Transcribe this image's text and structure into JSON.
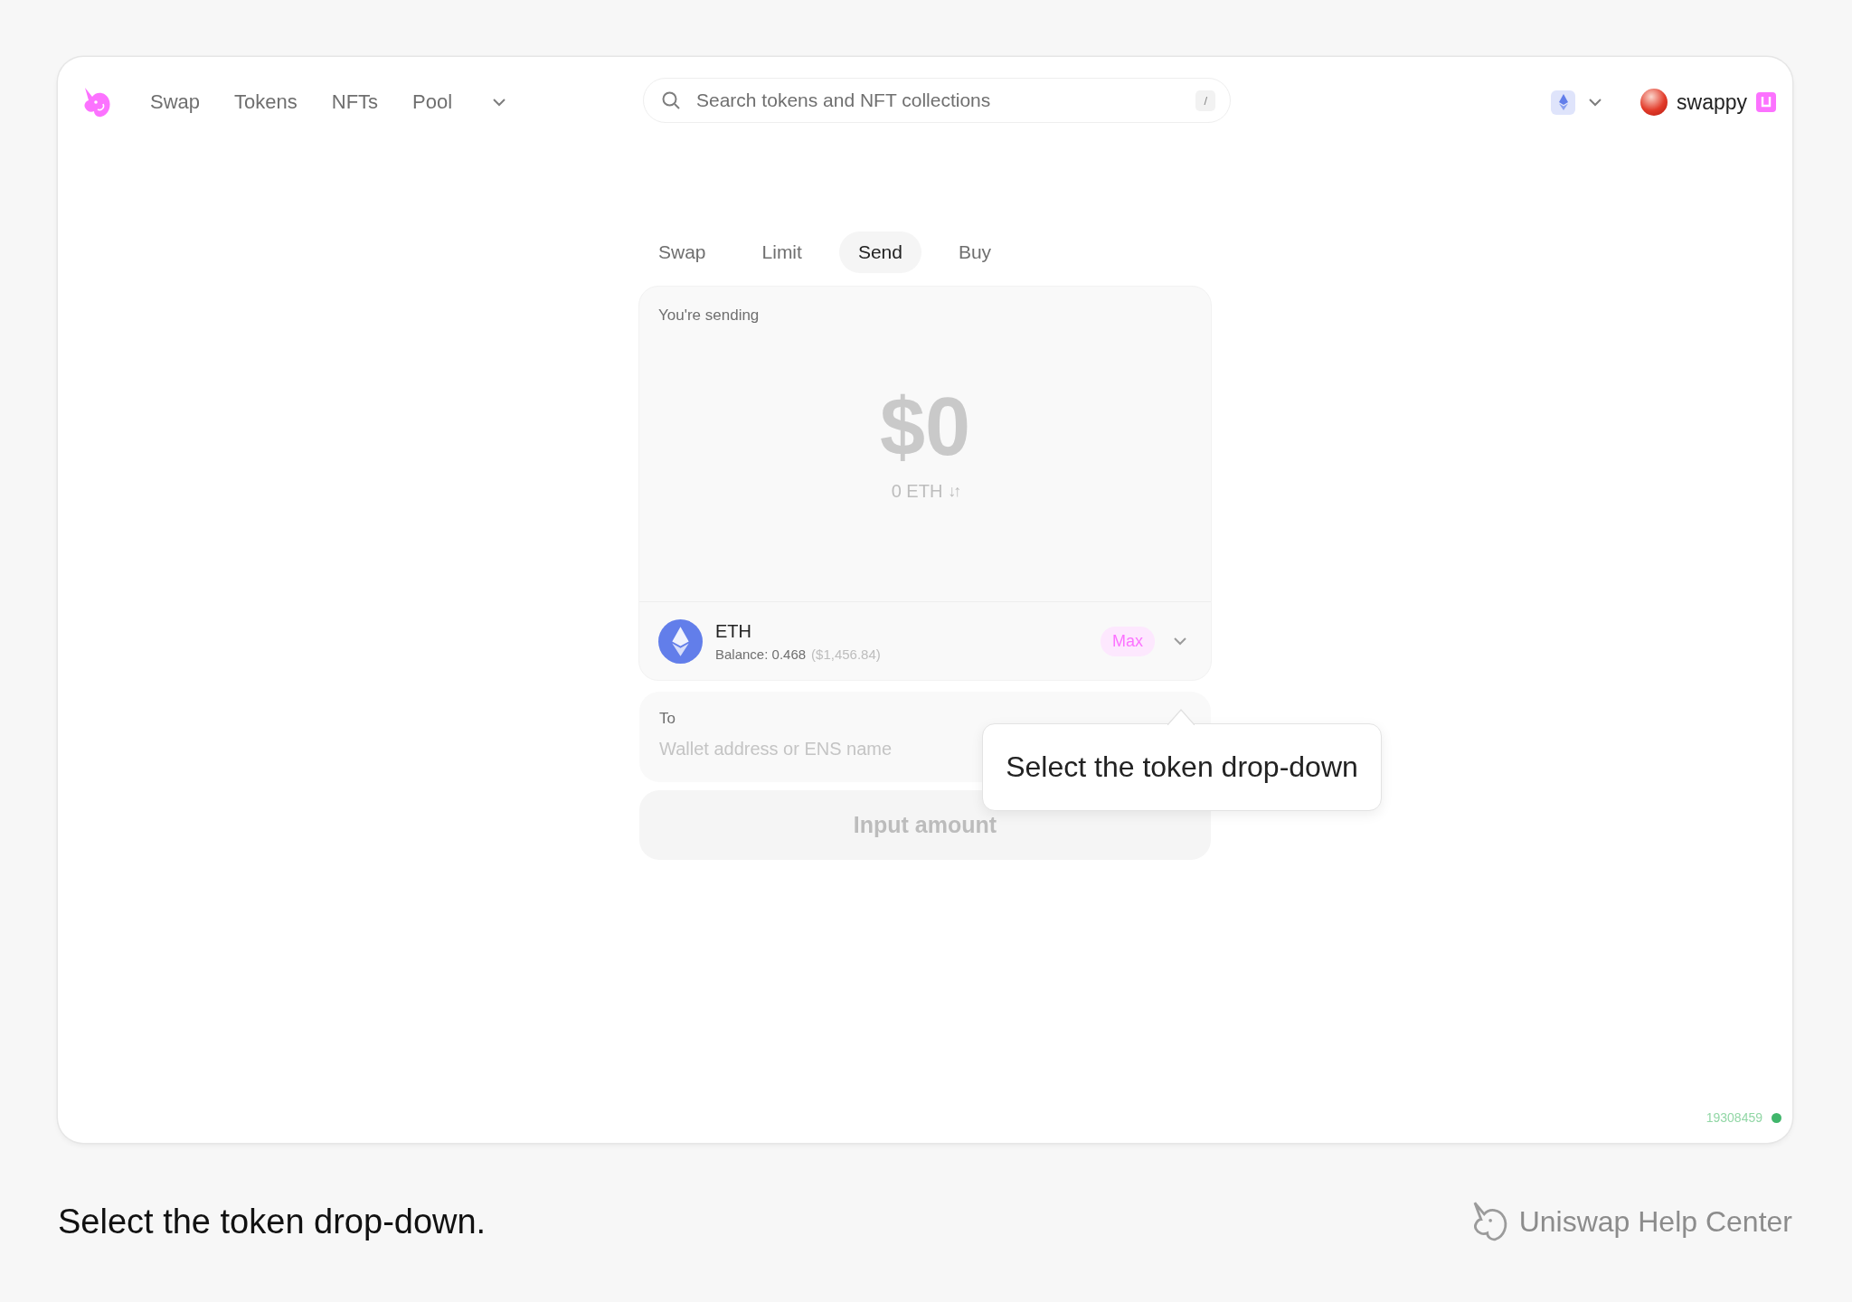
{
  "nav": {
    "items": [
      "Swap",
      "Tokens",
      "NFTs",
      "Pool"
    ]
  },
  "search": {
    "placeholder": "Search tokens and NFT collections",
    "shortcut": "/"
  },
  "account": {
    "name": "swappy"
  },
  "tabs": [
    {
      "label": "Swap",
      "selected": false
    },
    {
      "label": "Limit",
      "selected": false
    },
    {
      "label": "Send",
      "selected": true
    },
    {
      "label": "Buy",
      "selected": false
    }
  ],
  "send": {
    "label": "You're sending",
    "amount": "$0",
    "converted": "0 ETH",
    "toggle": "↓↑"
  },
  "token": {
    "symbol": "ETH",
    "balance_label": "Balance: 0.468",
    "balance_usd": "($1,456.84)",
    "max": "Max"
  },
  "recipient": {
    "label": "To",
    "placeholder": "Wallet address or ENS name"
  },
  "submit": {
    "label": "Input amount",
    "disabled": true
  },
  "tooltip": {
    "text": "Select the token drop-down"
  },
  "block": {
    "number": "19308459",
    "color": "#40b66b"
  },
  "caption": "Select the token drop-down.",
  "brand": "Uniswap Help Center"
}
